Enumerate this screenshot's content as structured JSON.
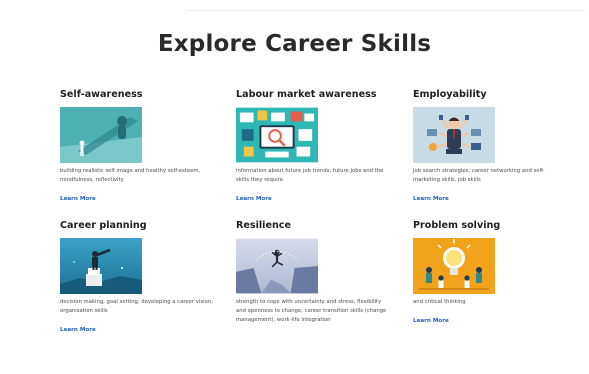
{
  "page": {
    "title": "Explore Career Skills"
  },
  "cards": [
    {
      "title": "Self-awareness",
      "description": "building realistic self image and healthy self-esteem, mindfulness, reflectivity",
      "link": "Learn More",
      "image_icon": "person-shadow-illustration",
      "accent": "#4fb0b4"
    },
    {
      "title": "Labour market awareness",
      "description": "information about future job trends, future jobs and the skills they require",
      "link": "Learn More",
      "image_icon": "labour-market-infographic",
      "accent": "#2fb7b3"
    },
    {
      "title": "Employability",
      "description": "job search strategies, career networking and self-marketing skills, job skills",
      "link": "Learn More",
      "image_icon": "multitasking-businessman",
      "accent": "#c9dbe4"
    },
    {
      "title": "Career planning",
      "description": "decision making, goal setting, developing a career vision, organisation skills",
      "link": "Learn More",
      "image_icon": "person-with-telescope",
      "accent": "#2b8db0"
    },
    {
      "title": "Resilience",
      "description": "strength to cope with uncertainty and stress, flexibility and openness to change, career transition skills (change management), work-life integration",
      "link": "",
      "image_icon": "jump-across-cliff",
      "accent": "#b9c3d8"
    },
    {
      "title": "Problem solving",
      "description": "and critical thinking",
      "link": "Learn More",
      "image_icon": "team-lightbulb",
      "accent": "#f3a31b"
    }
  ]
}
